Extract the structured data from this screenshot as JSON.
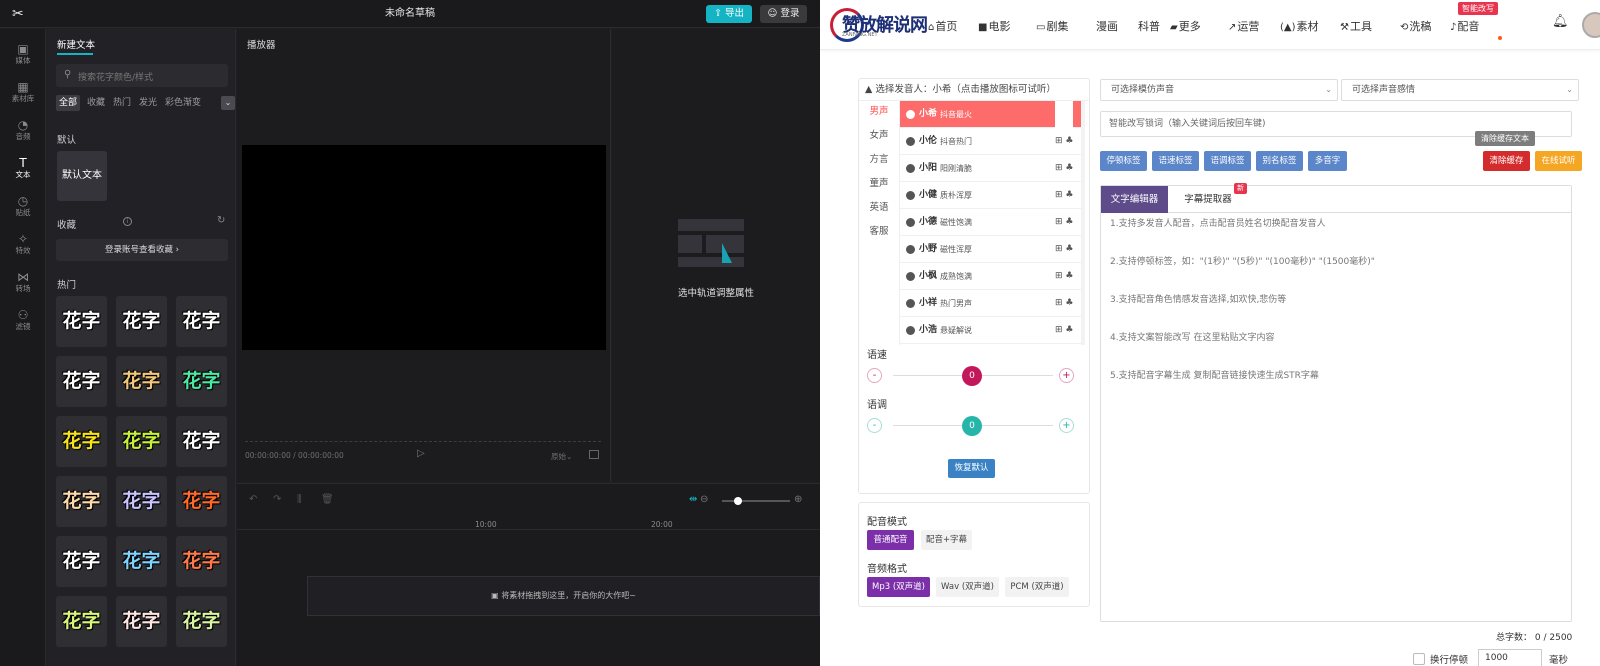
{
  "editor": {
    "title": "未命名草稿",
    "export_label": "导出",
    "login_label": "登录",
    "rail": [
      {
        "icon": "media-icon",
        "glyph": "▣",
        "label": "媒体"
      },
      {
        "icon": "library-icon",
        "glyph": "▦",
        "label": "素材库"
      },
      {
        "icon": "audio-icon",
        "glyph": "◔",
        "label": "音频"
      },
      {
        "icon": "text-icon",
        "glyph": "T",
        "label": "文本"
      },
      {
        "icon": "sticker-icon",
        "glyph": "◷",
        "label": "贴纸"
      },
      {
        "icon": "effects-icon",
        "glyph": "✧",
        "label": "特效"
      },
      {
        "icon": "transition-icon",
        "glyph": "⋈",
        "label": "转场"
      },
      {
        "icon": "filter-icon",
        "glyph": "⚇",
        "label": "滤镜"
      }
    ],
    "panel": {
      "tab": "新建文本",
      "search_placeholder": "搜索花字颜色/样式",
      "filters": [
        "全部",
        "收藏",
        "热门",
        "发光",
        "彩色渐变"
      ],
      "default_heading": "默认",
      "default_tile": "默认文本",
      "favorites_heading": "收藏",
      "favorites_login": "登录账号查看收藏",
      "hot_heading": "热门",
      "huazi_text": "花字",
      "huazi_colors": [
        "#ffffff",
        "#ffffff",
        "#ffffff",
        "#ffffff",
        "#f3c77b",
        "#4de8a3",
        "#f7e21b",
        "#c7f03b",
        "#ffffff",
        "#ffd9a8",
        "#c9c3ff",
        "#ff6a2a",
        "#ffffff",
        "#7fd3ff",
        "#ff7a4a",
        "#d9f57a",
        "#ffe4e4",
        "#d8f5a0"
      ]
    },
    "player": {
      "heading": "播放器",
      "time": "00:00:00:00 / 00:00:00:00",
      "ratio_label": "原始"
    },
    "properties_hint": "选中轨道调整属性",
    "timeline": {
      "ticks": [
        "10:00",
        "20:00"
      ],
      "drop_hint": "将素材拖拽到这里，开启你的大作吧~"
    }
  },
  "site": {
    "logo_text": "赞放解说网",
    "logo_sub": "ZANFANG.NET",
    "nav": [
      {
        "icon": "home-icon",
        "glyph": "⌂",
        "label": "首页"
      },
      {
        "icon": "movie-icon",
        "glyph": "■",
        "label": "电影"
      },
      {
        "icon": "tv-icon",
        "glyph": "▭",
        "label": "剧集"
      },
      {
        "icon": "",
        "glyph": "",
        "label": "漫画"
      },
      {
        "icon": "",
        "glyph": "",
        "label": "科普"
      },
      {
        "icon": "folder-icon",
        "glyph": "▰",
        "label": "更多"
      },
      {
        "icon": "chart-icon",
        "glyph": "↗",
        "label": "运营"
      },
      {
        "icon": "material-icon",
        "glyph": "(▲)",
        "label": "素材"
      },
      {
        "icon": "tool-icon",
        "glyph": "⚒",
        "label": "工具"
      },
      {
        "icon": "refresh-icon",
        "glyph": "⟲",
        "label": "洗稿"
      },
      {
        "icon": "mic-icon",
        "glyph": "♪",
        "label": "配音"
      }
    ],
    "nav_badge": "智能改写",
    "voice": {
      "header": "选择发音人：小希（点击播放图标可试听）",
      "categories": [
        "男声",
        "女声",
        "方言",
        "童声",
        "英语",
        "客服"
      ],
      "voices": [
        {
          "name": "小希",
          "desc": "抖音最火"
        },
        {
          "name": "小伦",
          "desc": "抖音热门"
        },
        {
          "name": "小阳",
          "desc": "阳刚清脆"
        },
        {
          "name": "小健",
          "desc": "质朴浑厚"
        },
        {
          "name": "小德",
          "desc": "磁性饱满"
        },
        {
          "name": "小野",
          "desc": "磁性浑厚"
        },
        {
          "name": "小枫",
          "desc": "成熟饱满"
        },
        {
          "name": "小祥",
          "desc": "热门男声"
        },
        {
          "name": "小浩",
          "desc": "悬疑解说"
        }
      ],
      "speed_label": "语速",
      "speed_value": "0",
      "pitch_label": "语调",
      "pitch_value": "0",
      "minus": "-",
      "plus": "+",
      "reset_label": "恢复默认",
      "colors": {
        "speed": "#c2185b",
        "pitch": "#26b5a8"
      }
    },
    "mode": {
      "mode_heading": "配音模式",
      "modes": [
        "普通配音",
        "配音+字幕"
      ],
      "format_heading": "音频格式",
      "formats": [
        "Mp3 (双声道)",
        "Wav (双声道)",
        "PCM (双声道)"
      ]
    },
    "selects": {
      "imitate_placeholder": "可选择模仿声音",
      "emotion_placeholder": "可选择声音感情"
    },
    "keyword_placeholder": "智能改写锁词（输入关键词后按回车键)",
    "tags": [
      "停顿标签",
      "语速标签",
      "语调标签",
      "别名标签",
      "多音字"
    ],
    "clear_cache_label": "清除缓存",
    "clear_cache_tip": "清除缓存文本",
    "trial_label": "在线试听",
    "tabs": {
      "editor": "文字编辑器",
      "subtitle": "字幕提取器",
      "new_badge": "新"
    },
    "tips": [
      "1.支持多发音人配音，点击配音员姓名切换配音发音人",
      "2.支持停顿标签，如：\"(1秒)\" \"(5秒)\" \"(100毫秒)\" \"(1500毫秒)\"",
      "3.支持配音角色情感发音选择,如欢快,悲伤等",
      "4.支持文案智能改写 在这里粘贴文字内容",
      "5.支持配音字幕生成 复制配音链接快速生成STR字幕"
    ],
    "count_label": "总字数：",
    "count_value": "0 / 2500",
    "wrap_label": "换行停顿",
    "wrap_ms_value": "1000",
    "wrap_ms_unit": "毫秒"
  }
}
